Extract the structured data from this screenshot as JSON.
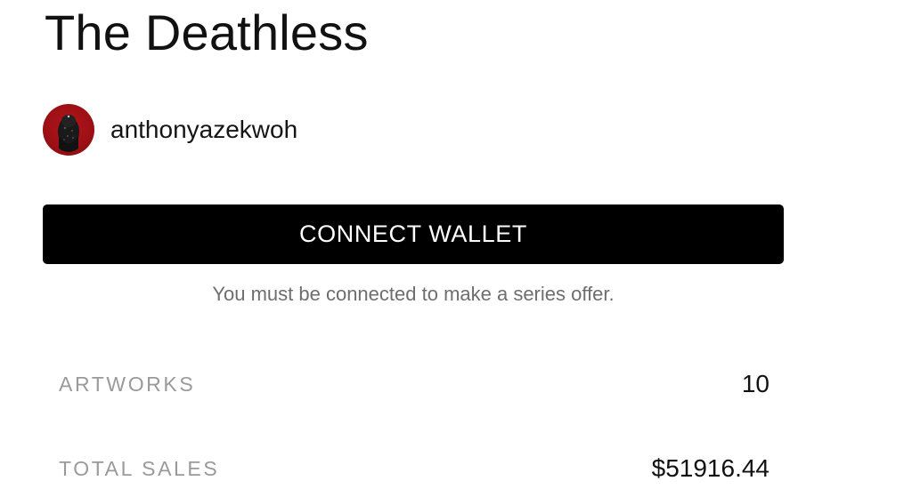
{
  "series": {
    "title": "The Deathless"
  },
  "artist": {
    "username": "anthonyazekwoh",
    "avatar_icon": "artist-avatar-image"
  },
  "actions": {
    "connect_wallet_label": "CONNECT WALLET",
    "connect_notice": "You must be connected to make a series offer."
  },
  "stats": {
    "artworks": {
      "label": "ARTWORKS",
      "value": "10"
    },
    "total_sales": {
      "label": "TOTAL SALES",
      "value": "$51916.44"
    }
  },
  "colors": {
    "button_background": "#000000",
    "button_text": "#ffffff",
    "stat_label": "#9a9a9a",
    "notice_text": "#6e6e6e",
    "avatar_background": "#b3141a"
  }
}
